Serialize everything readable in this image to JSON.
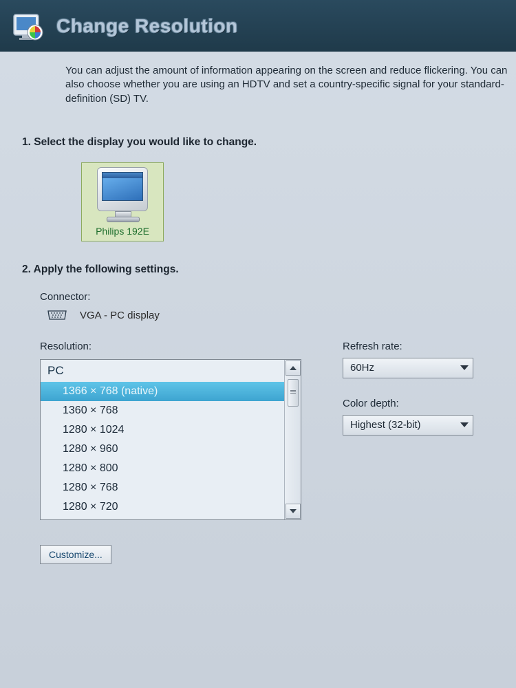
{
  "header": {
    "title": "Change Resolution"
  },
  "intro_text": "You can adjust the amount of information appearing on the screen and reduce flickering. You can also choose whether you are using an HDTV and set a country-specific signal for your standard-definition (SD) TV.",
  "section1": {
    "title": "1. Select the display you would like to change.",
    "display_name": "Philips 192E"
  },
  "section2": {
    "title": "2. Apply the following settings.",
    "connector_label": "Connector:",
    "connector_value": "VGA - PC display",
    "resolution_label": "Resolution:",
    "resolution_group": "PC",
    "resolutions": [
      "1366 × 768 (native)",
      "1360 × 768",
      "1280 × 1024",
      "1280 × 960",
      "1280 × 800",
      "1280 × 768",
      "1280 × 720"
    ],
    "selected_index": 0,
    "refresh_label": "Refresh rate:",
    "refresh_value": "60Hz",
    "color_label": "Color depth:",
    "color_value": "Highest (32-bit)",
    "customize_label": "Customize..."
  }
}
